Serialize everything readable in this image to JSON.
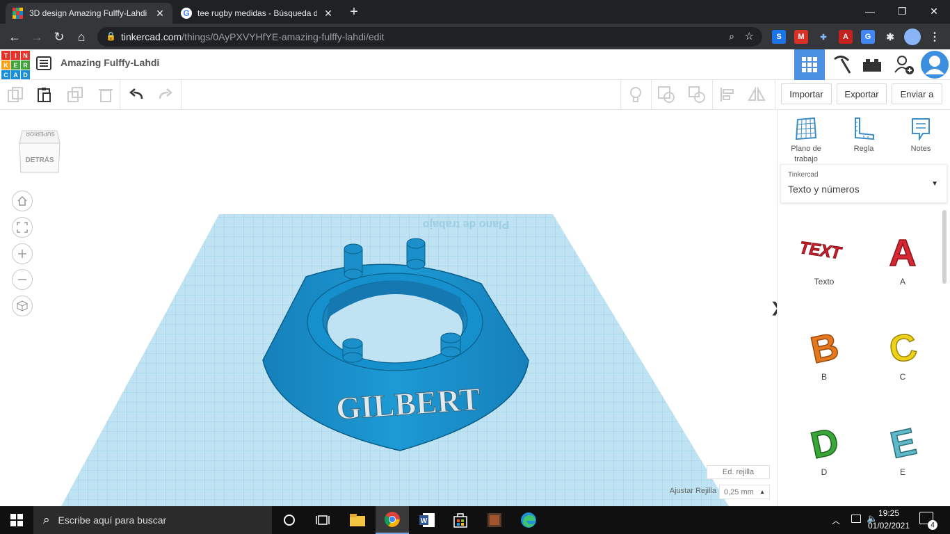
{
  "browser": {
    "tabs": [
      {
        "title": "3D design Amazing Fulffy-Lahdi |",
        "active": true
      },
      {
        "title": "tee rugby medidas - Búsqueda de",
        "active": false
      }
    ],
    "new_tab": "+",
    "url_host": "tinkercad.com",
    "url_path": "/things/0AyPXVYHfYE-amazing-fulffy-lahdi/edit"
  },
  "app": {
    "logo_letters": [
      "T",
      "I",
      "N",
      "K",
      "E",
      "R",
      "C",
      "A",
      "D"
    ],
    "design_title": "Amazing Fulffy-Lahdi",
    "toolbar": {
      "import": "Importar",
      "export": "Exportar",
      "send": "Enviar a"
    }
  },
  "viewcube": {
    "top": "SUPERIOR",
    "back": "DETRÁS"
  },
  "workspace": {
    "workplane_label": "Plano de trabajo",
    "model_text": "GILBERT",
    "edit_grid": "Ed. rejilla",
    "snap_label": "Ajustar Rejilla",
    "snap_value": "0,25 mm"
  },
  "sidebar": {
    "tools": [
      {
        "label": "Plano de trabajo",
        "icon": "workplane-icon"
      },
      {
        "label": "Regla",
        "icon": "ruler-icon"
      },
      {
        "label": "Notes",
        "icon": "notes-icon"
      }
    ],
    "library_source": "Tinkercad",
    "library_name": "Texto y números",
    "shapes": [
      {
        "label": "Texto",
        "color": "#c8202c"
      },
      {
        "label": "A",
        "color": "#d62833"
      },
      {
        "label": "B",
        "color": "#e4781e"
      },
      {
        "label": "C",
        "color": "#eed21a"
      },
      {
        "label": "D",
        "color": "#3aa63a"
      },
      {
        "label": "E",
        "color": "#5fb8c8"
      }
    ]
  },
  "taskbar": {
    "search_placeholder": "Escribe aquí para buscar",
    "time": "19:25",
    "date": "01/02/2021",
    "notifications": "4"
  },
  "colors": {
    "accent": "#1f9bd7",
    "model": "#1a8fc9",
    "workplane": "#a8d8ec"
  }
}
